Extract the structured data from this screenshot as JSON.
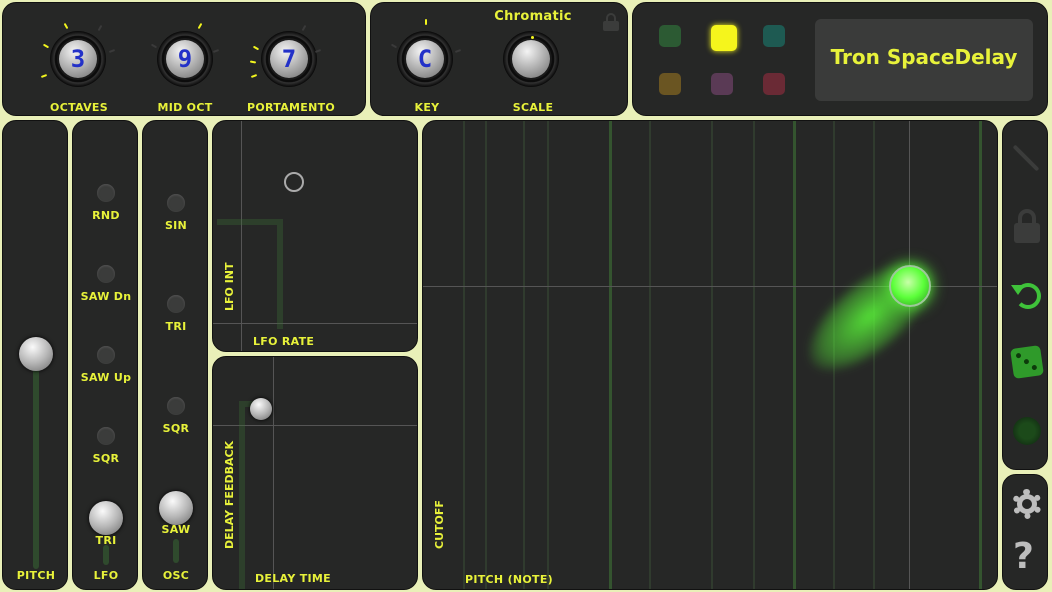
{
  "knobs": {
    "octaves": {
      "value": "3",
      "label": "OCTAVES"
    },
    "mid_oct": {
      "value": "9",
      "label": "MID OCT"
    },
    "portamento": {
      "value": "7",
      "label": "PORTAMENTO"
    },
    "key": {
      "value": "C",
      "label": "KEY"
    },
    "scale": {
      "value": "",
      "label": "SCALE"
    }
  },
  "scale_name": "Chromatic",
  "preset_name": "Tron SpaceDelay",
  "swatches": [
    {
      "color": "#2c5a33"
    },
    {
      "color": "#f5f51c"
    },
    {
      "color": "#1e5a52"
    },
    {
      "color": "#6a5522"
    },
    {
      "color": "#5a3a55"
    },
    {
      "color": "#6a2a35"
    }
  ],
  "pitch_label": "PITCH",
  "lfo": {
    "options": [
      "RND",
      "SAW Dn",
      "SAW Up",
      "SQR",
      "TRI"
    ],
    "selected": "TRI",
    "label": "LFO"
  },
  "osc": {
    "options": [
      "SIN",
      "TRI",
      "SQR",
      "SAW"
    ],
    "selected": "SAW",
    "label": "OSC"
  },
  "lfo_pad": {
    "x_label": "LFO RATE",
    "y_label": "LFO INT"
  },
  "delay_pad": {
    "x_label": "DELAY TIME",
    "y_label": "DELAY FEEDBACK"
  },
  "main_pad": {
    "x_label": "PITCH (NOTE)",
    "y_label": "CUTOFF"
  },
  "colors": {
    "accent": "#e8f23a",
    "panel": "#262726",
    "background": "#e9f0b8",
    "glow": "#5cff3a"
  },
  "side_icons": [
    "edit-icon",
    "lock-icon",
    "undo-icon",
    "dice-icon",
    "record-icon"
  ],
  "bottom_icons": [
    "gear-icon",
    "help-icon"
  ]
}
